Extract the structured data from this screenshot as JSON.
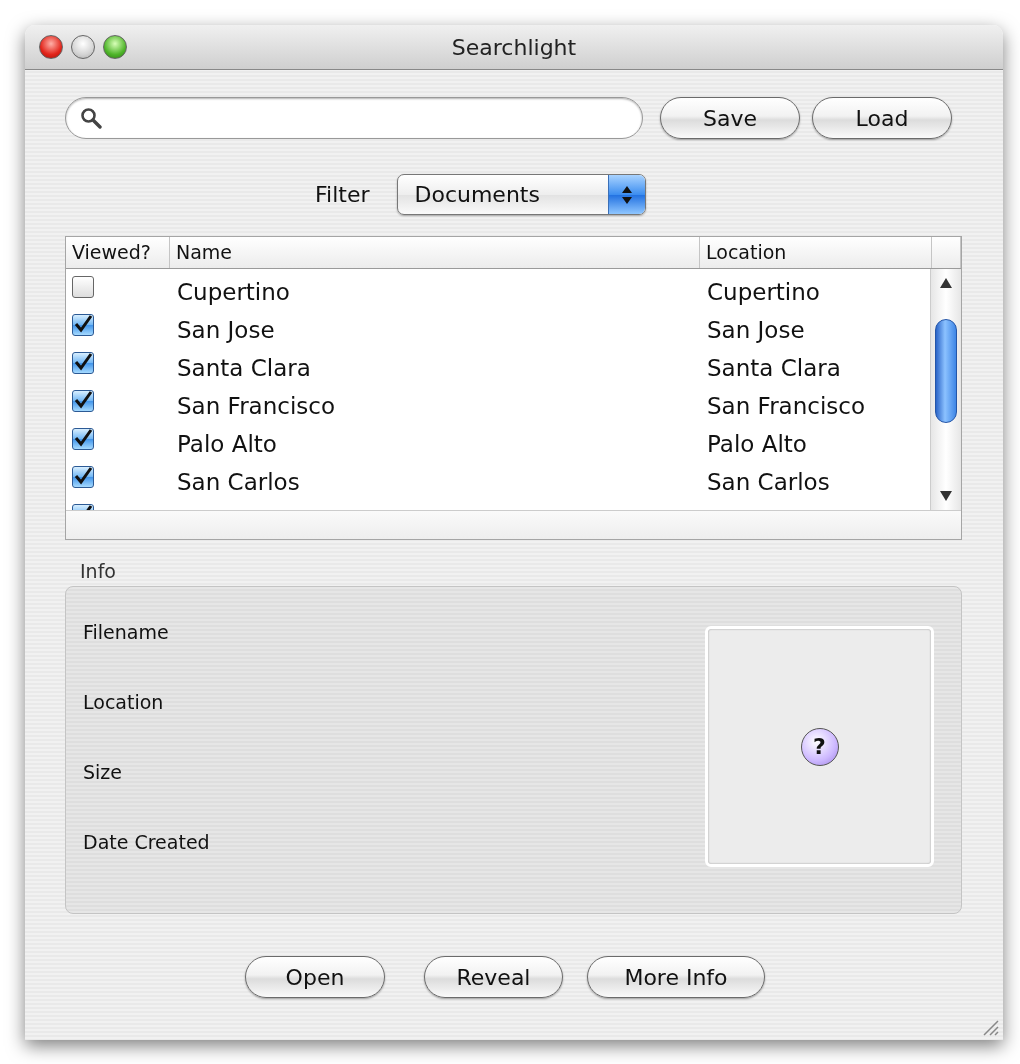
{
  "window": {
    "title": "Searchlight"
  },
  "top_buttons": [
    "Save",
    "Load"
  ],
  "filter": {
    "label": "Filter",
    "value": "Documents"
  },
  "table": {
    "columns": [
      "Viewed?",
      "Name",
      "Location"
    ],
    "rows": [
      {
        "viewed": false,
        "name": "Cupertino",
        "location": "Cupertino"
      },
      {
        "viewed": true,
        "name": "San Jose",
        "location": "San Jose"
      },
      {
        "viewed": true,
        "name": "Santa Clara",
        "location": "Santa Clara"
      },
      {
        "viewed": true,
        "name": "San Francisco",
        "location": "San Francisco"
      },
      {
        "viewed": true,
        "name": "Palo Alto",
        "location": "Palo Alto"
      },
      {
        "viewed": true,
        "name": "San Carlos",
        "location": "San Carlos"
      },
      {
        "viewed": true
      }
    ]
  },
  "info": {
    "title": "Info",
    "fields": [
      "Filename",
      "Location",
      "Size",
      "Date Created"
    ],
    "preview_icon": "?"
  },
  "bottom_buttons": [
    "Open",
    "Reveal",
    "More Info"
  ]
}
